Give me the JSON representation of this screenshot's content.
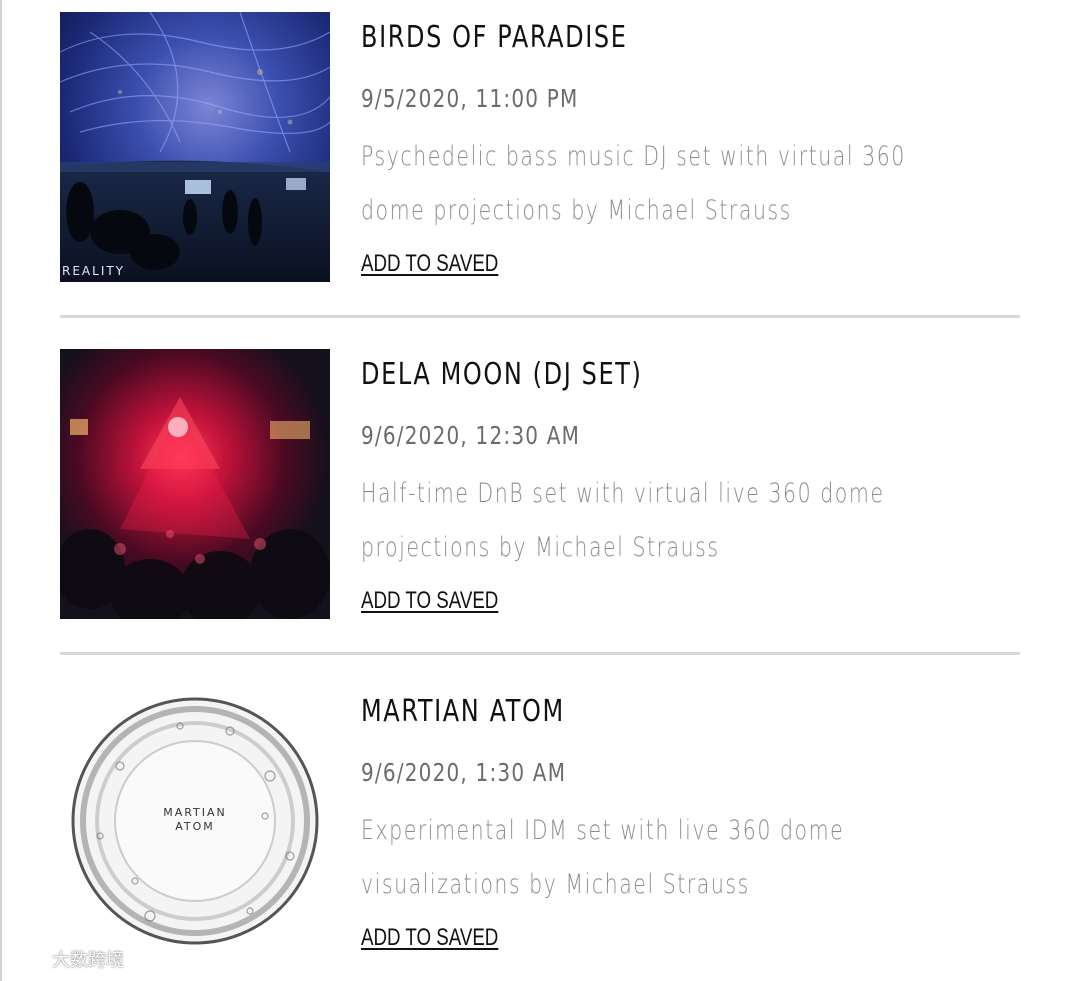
{
  "events": [
    {
      "title": "BIRDS OF PARADISE",
      "datetime": "9/5/2020, 11:00 PM",
      "description": "Psychedelic bass music DJ set with virtual 360 dome projections by Michael Strauss",
      "save_label": "ADD TO SAVED",
      "image_caption": "REALITY"
    },
    {
      "title": "DELA MOON (DJ SET)",
      "datetime": "9/6/2020, 12:30 AM",
      "description": "Half-time DnB set with virtual live 360 dome projections by Michael Strauss",
      "save_label": "ADD TO SAVED"
    },
    {
      "title": "MARTIAN ATOM",
      "datetime": "9/6/2020, 1:30 AM",
      "description": "Experimental IDM set with live 360 dome visualizations by Michael Strauss",
      "save_label": "ADD TO SAVED",
      "image_caption": "MARTIAN ATOM"
    }
  ],
  "watermark": "大数跨境"
}
